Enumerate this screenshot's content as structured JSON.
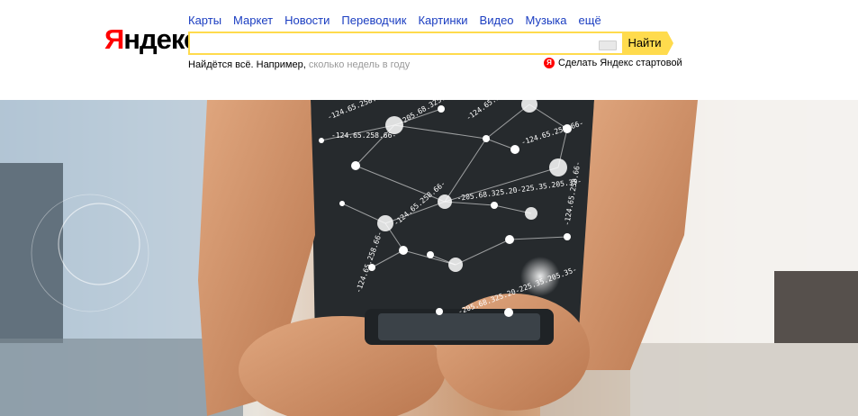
{
  "logo": {
    "first": "Я",
    "rest": "ндекс"
  },
  "nav": [
    {
      "label": "Карты"
    },
    {
      "label": "Маркет"
    },
    {
      "label": "Новости"
    },
    {
      "label": "Переводчик"
    },
    {
      "label": "Картинки"
    },
    {
      "label": "Видео"
    },
    {
      "label": "Музыка"
    },
    {
      "label": "ещё"
    }
  ],
  "search": {
    "value": "",
    "placeholder": "",
    "button_label": "Найти"
  },
  "hint": {
    "prefix": "Найдётся всё. Например,",
    "example": "сколько недель в году"
  },
  "homepage": {
    "icon_letter": "Я",
    "label": "Сделать Яндекс стартовой"
  },
  "banner": {
    "ip_labels": [
      "-124.65.258.66-",
      "-205.68.325.20-",
      "-124.65.258.66-",
      "-205.68.325.20-225.35.205.35-",
      "-124.65.258.66-",
      "-124.65.258.66-",
      "-205.68.325.20-225.35.205.35-",
      "-124.65.258.66-",
      "-124.65.258.66-",
      "-124.65.258.66-"
    ]
  },
  "colors": {
    "accent": "#ffdb4d",
    "logo_red": "#ff0000",
    "link": "#1a3dc1",
    "hint_gray": "#999999"
  }
}
